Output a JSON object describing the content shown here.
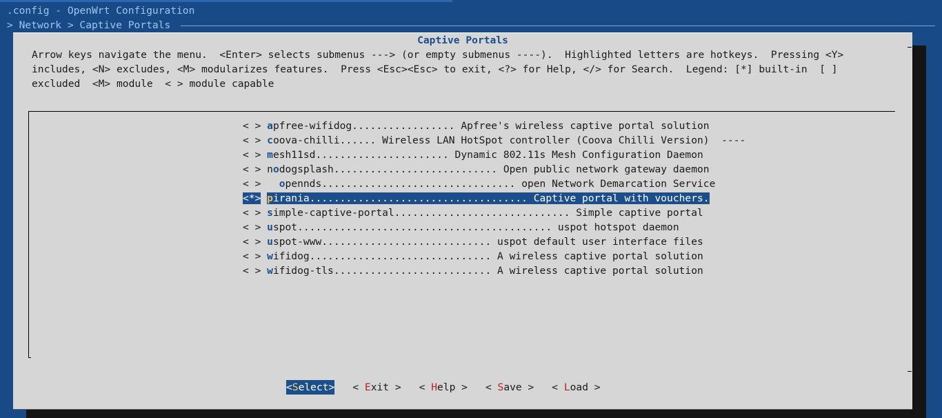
{
  "window": {
    "title": ".config - OpenWrt Configuration"
  },
  "breadcrumb": {
    "text": "> Network > Captive Portals"
  },
  "dialog": {
    "title": "Captive Portals",
    "help_lines": [
      "Arrow keys navigate the menu.  <Enter> selects submenus ---> (or empty submenus ----).  Highlighted letters are hotkeys.  Pressing <Y>",
      "includes, <N> excludes, <M> modularizes features.  Press <Esc><Esc> to exit, <?> for Help, </> for Search.  Legend: [*] built-in  [ ]",
      "excluded  <M> module  < > module capable"
    ]
  },
  "menu": {
    "items": [
      {
        "state": " ",
        "indent": "",
        "hotkey": "a",
        "rest": "pfree-wifidog................. Apfree's wireless captive portal solution",
        "selected": false
      },
      {
        "state": " ",
        "indent": "",
        "hotkey": "c",
        "rest": "oova-chilli...... Wireless LAN HotSpot controller (Coova Chilli Version)  ----",
        "selected": false
      },
      {
        "state": " ",
        "indent": "",
        "hotkey": "m",
        "rest": "esh11sd...................... Dynamic 802.11s Mesh Configuration Daemon",
        "selected": false
      },
      {
        "state": " ",
        "indent": "",
        "hotkey": "n",
        "rest": "odogsplash........................... Open public network gateway daemon",
        "selected": false,
        "hotkey_index": 1
      },
      {
        "state": " ",
        "indent": "  ",
        "hotkey": "o",
        "rest": "pennds................................ open Network Demarcation Service",
        "selected": false
      },
      {
        "state": "*",
        "indent": "",
        "hotkey": "p",
        "rest": "irania.................................... Captive portal with vouchers.",
        "selected": true
      },
      {
        "state": " ",
        "indent": "",
        "hotkey": "s",
        "rest": "imple-captive-portal............................. Simple captive portal",
        "selected": false
      },
      {
        "state": " ",
        "indent": "",
        "hotkey": "u",
        "rest": "spot.......................................... uspot hotspot daemon",
        "selected": false
      },
      {
        "state": " ",
        "indent": "",
        "hotkey": "u",
        "rest": "spot-www............................ uspot default user interface files",
        "selected": false
      },
      {
        "state": " ",
        "indent": "",
        "hotkey": "w",
        "rest": "ifidog.............................. A wireless captive portal solution",
        "selected": false
      },
      {
        "state": " ",
        "indent": "",
        "hotkey": "w",
        "rest": "ifidog-tls.......................... A wireless captive portal solution",
        "selected": false
      }
    ]
  },
  "buttons": [
    {
      "open": "<",
      "hotkey": "S",
      "rest": "elect",
      "close": ">",
      "active": true
    },
    {
      "open": "< ",
      "hotkey": "E",
      "rest": "xit",
      "close": " >",
      "active": false
    },
    {
      "open": "< ",
      "hotkey": "H",
      "rest": "elp",
      "close": " >",
      "active": false
    },
    {
      "open": "< ",
      "hotkey": "S",
      "rest": "ave",
      "close": " >",
      "active": false
    },
    {
      "open": "< ",
      "hotkey": "L",
      "rest": "oad",
      "close": " >",
      "active": false
    }
  ],
  "colors": {
    "background": "#174a86",
    "dialog": "#d6d6d6",
    "accent": "#1c4e8c",
    "hotkey_red": "#b22222"
  }
}
